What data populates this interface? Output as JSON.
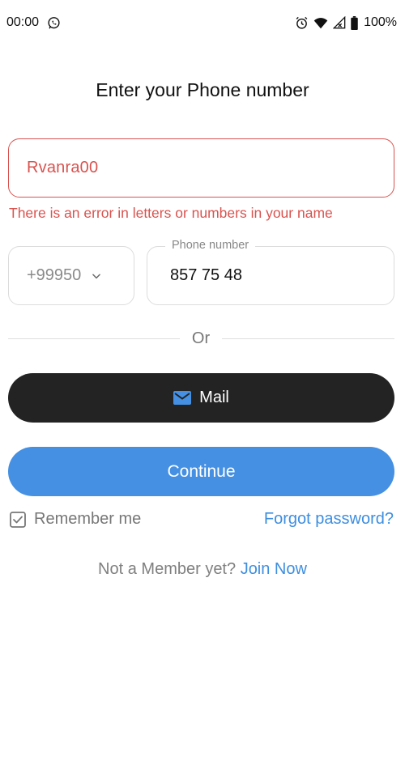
{
  "status_bar": {
    "time": "00:00",
    "battery": "100%",
    "icons": [
      "whatsapp-icon",
      "alarm-icon",
      "wifi-icon",
      "signal-icon",
      "battery-icon"
    ]
  },
  "title": "Enter your Phone number",
  "name_field": {
    "value": "Rvanra00",
    "error": "There is an error in letters or numbers in your name"
  },
  "phone": {
    "country_code": "+99950",
    "label": "Phone number",
    "value": "857 75 48"
  },
  "divider_text": "Or",
  "mail_button": {
    "label": "Mail",
    "icon": "mail-icon"
  },
  "continue_button": {
    "label": "Continue"
  },
  "remember_me": {
    "label": "Remember me",
    "checked": true
  },
  "forgot_password": "Forgot password?",
  "join": {
    "prompt": "Not a Member yet?",
    "link": "Join Now"
  },
  "colors": {
    "error": "#d9534f",
    "primary": "#4590e2",
    "link": "#3d8ee0",
    "dark_button": "#232323",
    "mail_icon": "#4590e2"
  }
}
